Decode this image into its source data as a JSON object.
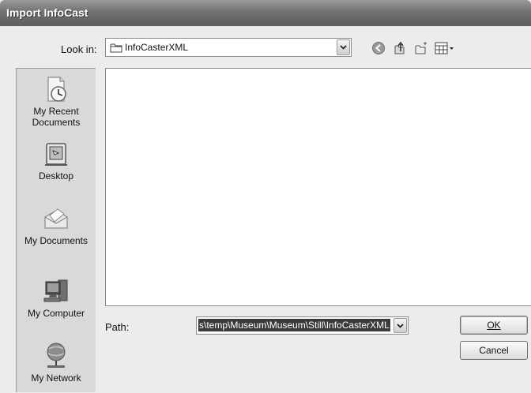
{
  "window": {
    "title": "Import InfoCast"
  },
  "look_in": {
    "label": "Look in:",
    "value": "InfoCasterXML",
    "icon": "folder-icon"
  },
  "toolbar": {
    "icons": [
      "back-icon",
      "up-folder-icon",
      "new-folder-icon",
      "view-menu-icon"
    ]
  },
  "places": [
    {
      "label": "My Recent Documents",
      "icon": "recent-documents-icon"
    },
    {
      "label": "Desktop",
      "icon": "desktop-icon"
    },
    {
      "label": "My Documents",
      "icon": "my-documents-icon"
    },
    {
      "label": "My Computer",
      "icon": "my-computer-icon"
    },
    {
      "label": "My Network",
      "icon": "my-network-icon"
    }
  ],
  "path": {
    "label": "Path:",
    "value": "s\\temp\\Museum\\Museum\\Still\\InfoCasterXML"
  },
  "buttons": {
    "ok": "OK",
    "cancel": "Cancel"
  }
}
